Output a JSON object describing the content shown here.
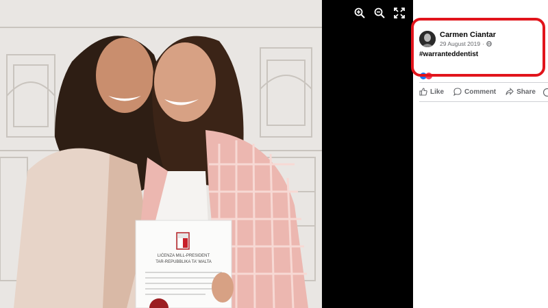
{
  "post": {
    "author": "Carmen Ciantar",
    "date": "29 August 2019",
    "audience_icon": "globe-icon",
    "text": "#warranteddentist"
  },
  "actions": {
    "like": "Like",
    "comment": "Comment",
    "share": "Share"
  },
  "photo": {
    "certificate_line1": "LIĊENZA MILL-PRESIDENT",
    "certificate_line2": "TAR-REPUBBLIKA TA' MALTA"
  },
  "viewer": {
    "tools": [
      "zoom-in-icon",
      "zoom-out-icon",
      "fullscreen-icon"
    ]
  },
  "colors": {
    "highlight": "#e1141b",
    "viewer_bg": "#000000",
    "muted_text": "#65676b"
  }
}
